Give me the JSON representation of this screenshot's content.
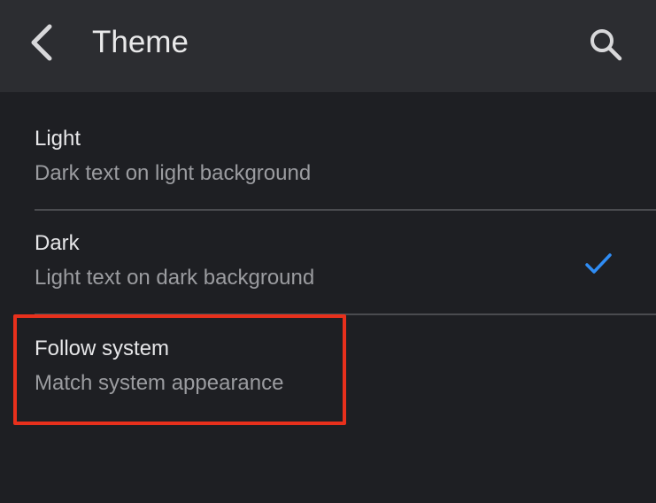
{
  "header": {
    "title": "Theme",
    "back_icon": "chevron-left-icon",
    "search_icon": "search-icon"
  },
  "options": [
    {
      "label": "Light",
      "description": "Dark text on light background",
      "selected": false
    },
    {
      "label": "Dark",
      "description": "Light text on dark background",
      "selected": true
    },
    {
      "label": "Follow system",
      "description": "Match system appearance",
      "selected": false
    }
  ],
  "colors": {
    "background": "#1e1f23",
    "topbar": "#2c2d31",
    "checkmark": "#2f8cf4",
    "highlight_border": "#e8301c"
  }
}
